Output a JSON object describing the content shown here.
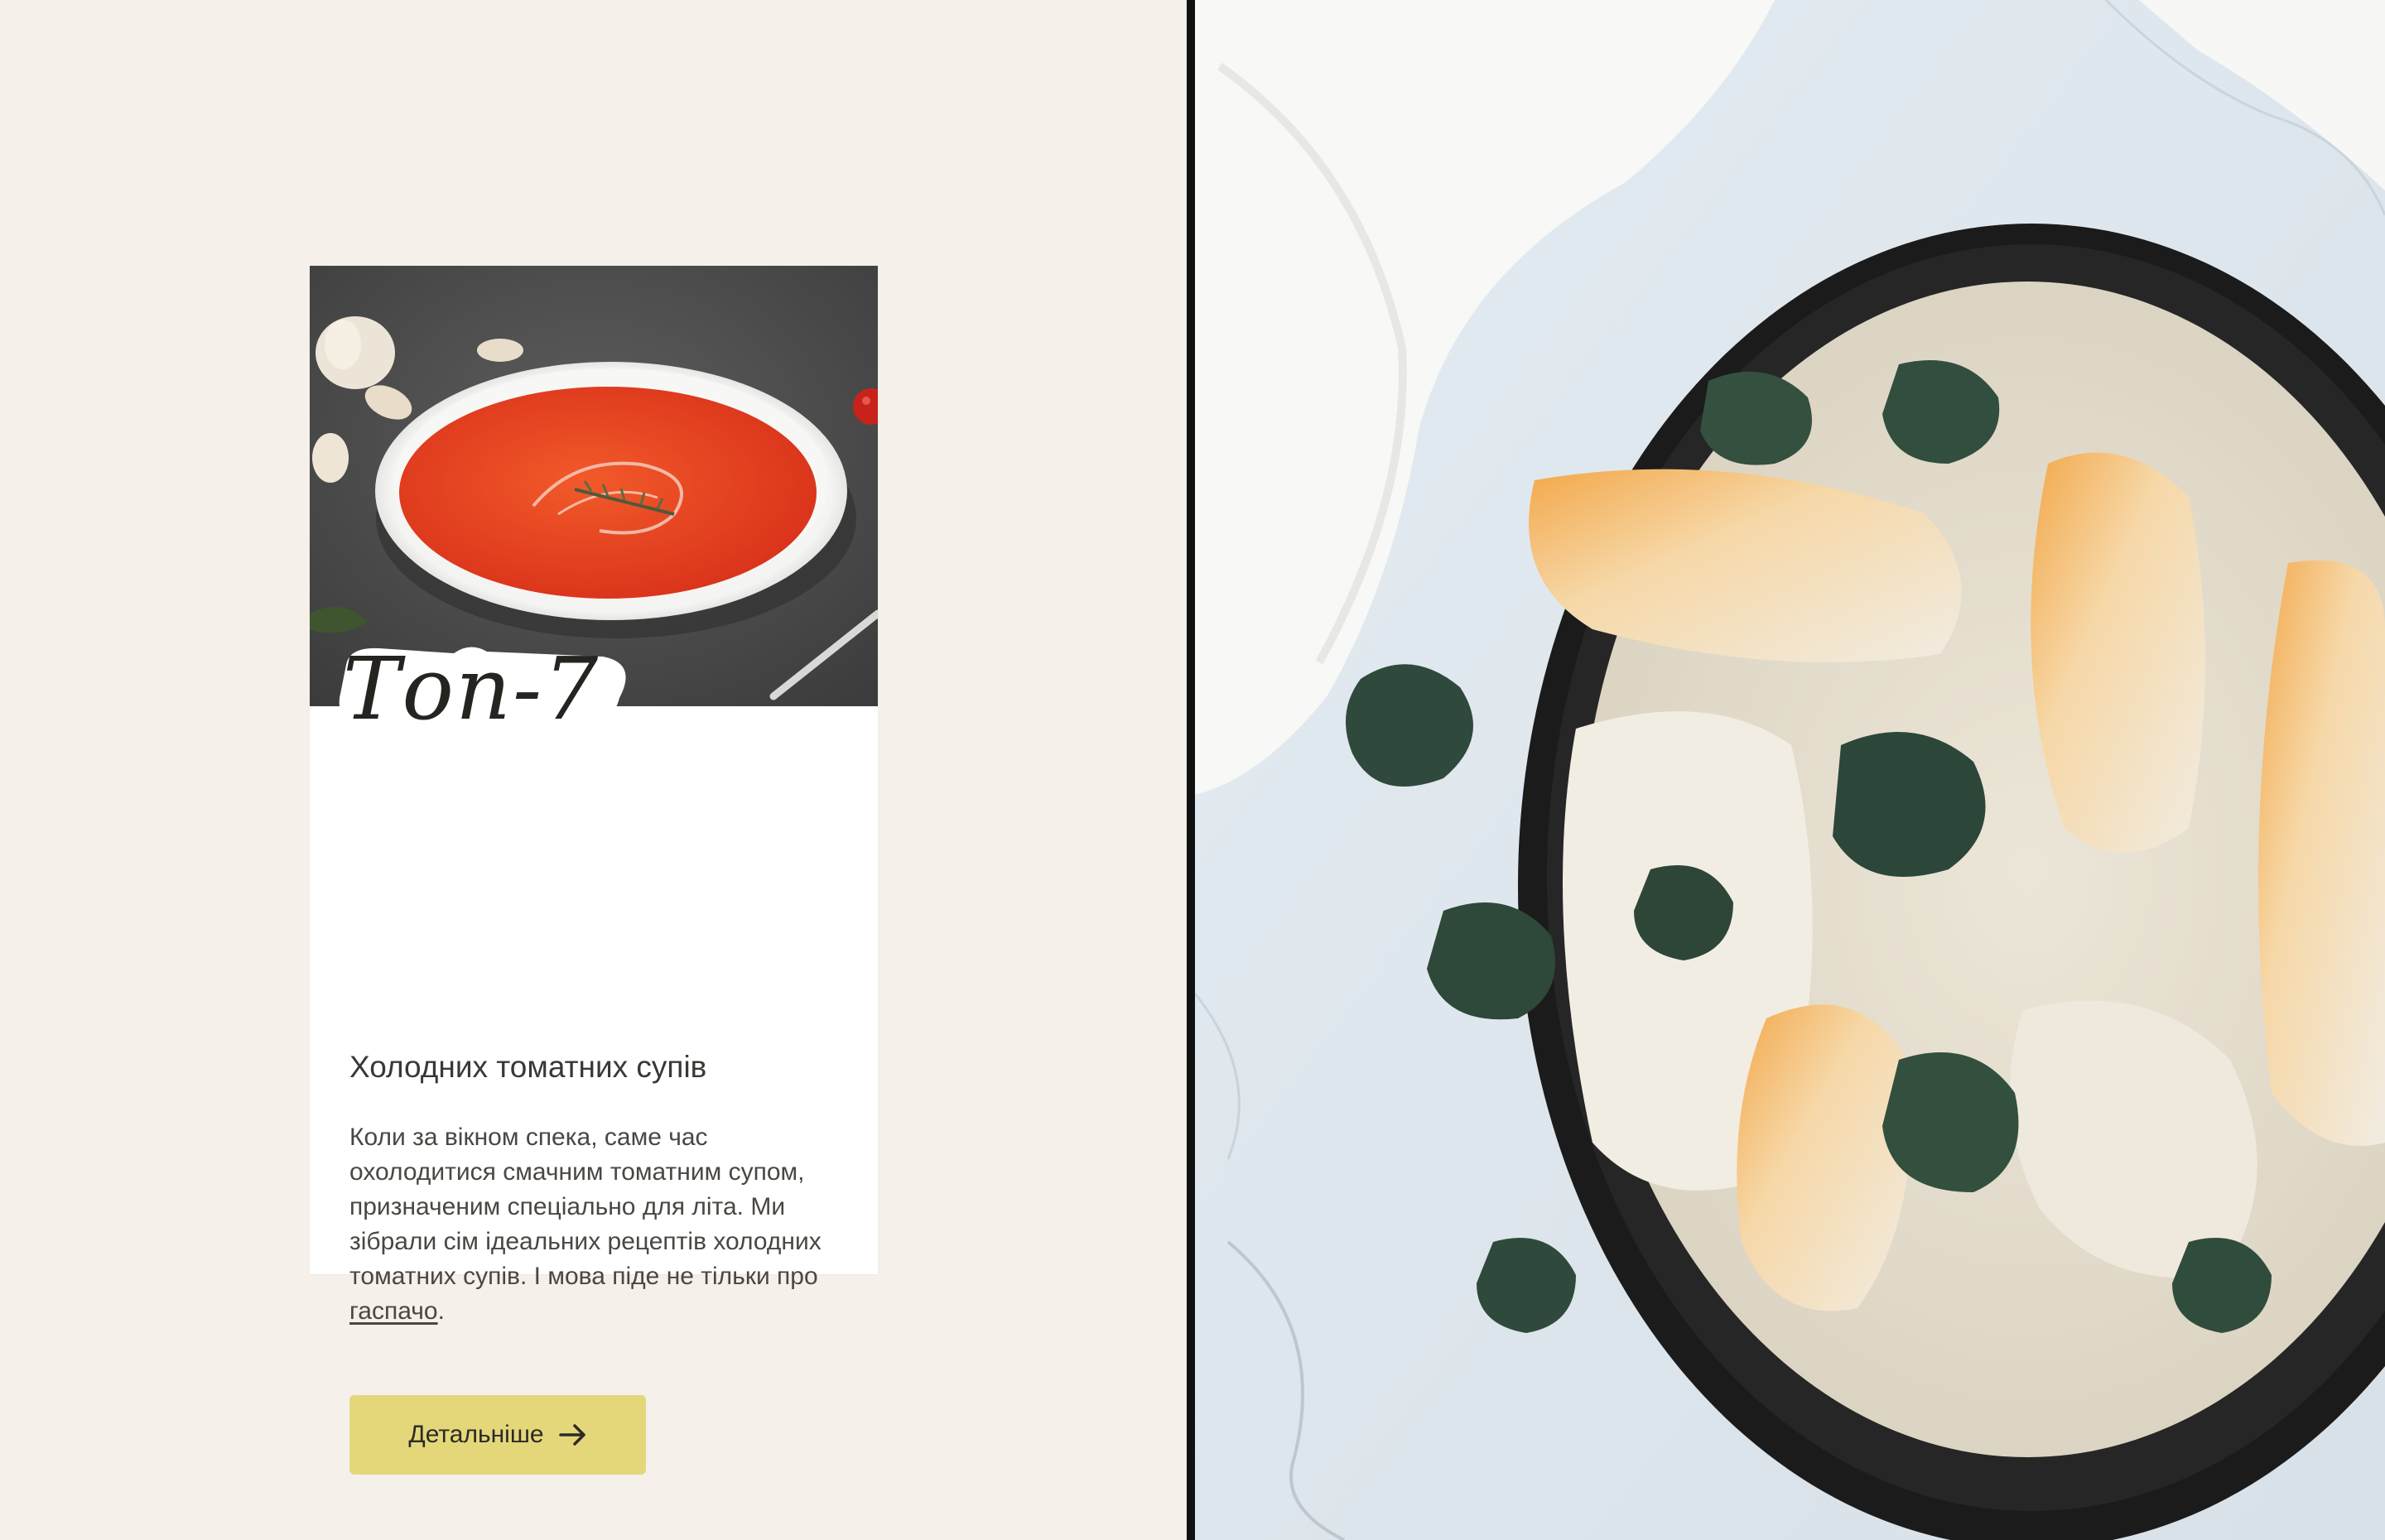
{
  "card": {
    "badge_text": "Топ-7",
    "heading": "Холодних томатних супів",
    "body_text": "Коли за вікном спека, саме час охолодитися смачним томатним супом, призначеним спеціально для літа. Ми зібрали сім ідеальних рецептів холодних томатних супів. І мова піде не тільки про ",
    "body_link": "гаспачо",
    "body_end": ".",
    "button_label": "Детальніше",
    "button_icon": "arrow-right-icon"
  },
  "colors": {
    "page_background": "#f5f0ea",
    "card_background": "#ffffff",
    "button_background": "#e4d77a",
    "divider": "#111111"
  }
}
